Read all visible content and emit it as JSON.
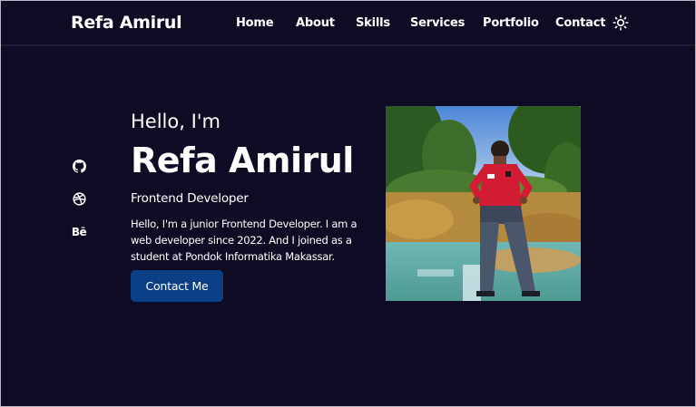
{
  "header": {
    "brand": "Refa Amirul",
    "nav": [
      "Home",
      "About",
      "Skills",
      "Services",
      "Portfolio",
      "Contact"
    ],
    "theme_toggle_icon": "sun-icon"
  },
  "social": [
    "github-icon",
    "dribbble-icon",
    "behance-icon"
  ],
  "social_labels": {
    "behance": "Bē"
  },
  "hero": {
    "greeting": "Hello, I'm",
    "name": "Refa Amirul",
    "role": "Frontend Developer",
    "description": "Hello, I'm a junior Frontend Developer. I am a web developer since 2022. And I joined as a student at Pondok Informatika Makassar.",
    "cta": "Contact Me"
  },
  "colors": {
    "background": "#0e0c24",
    "button": "#0b3f86",
    "text": "#ffffff"
  }
}
